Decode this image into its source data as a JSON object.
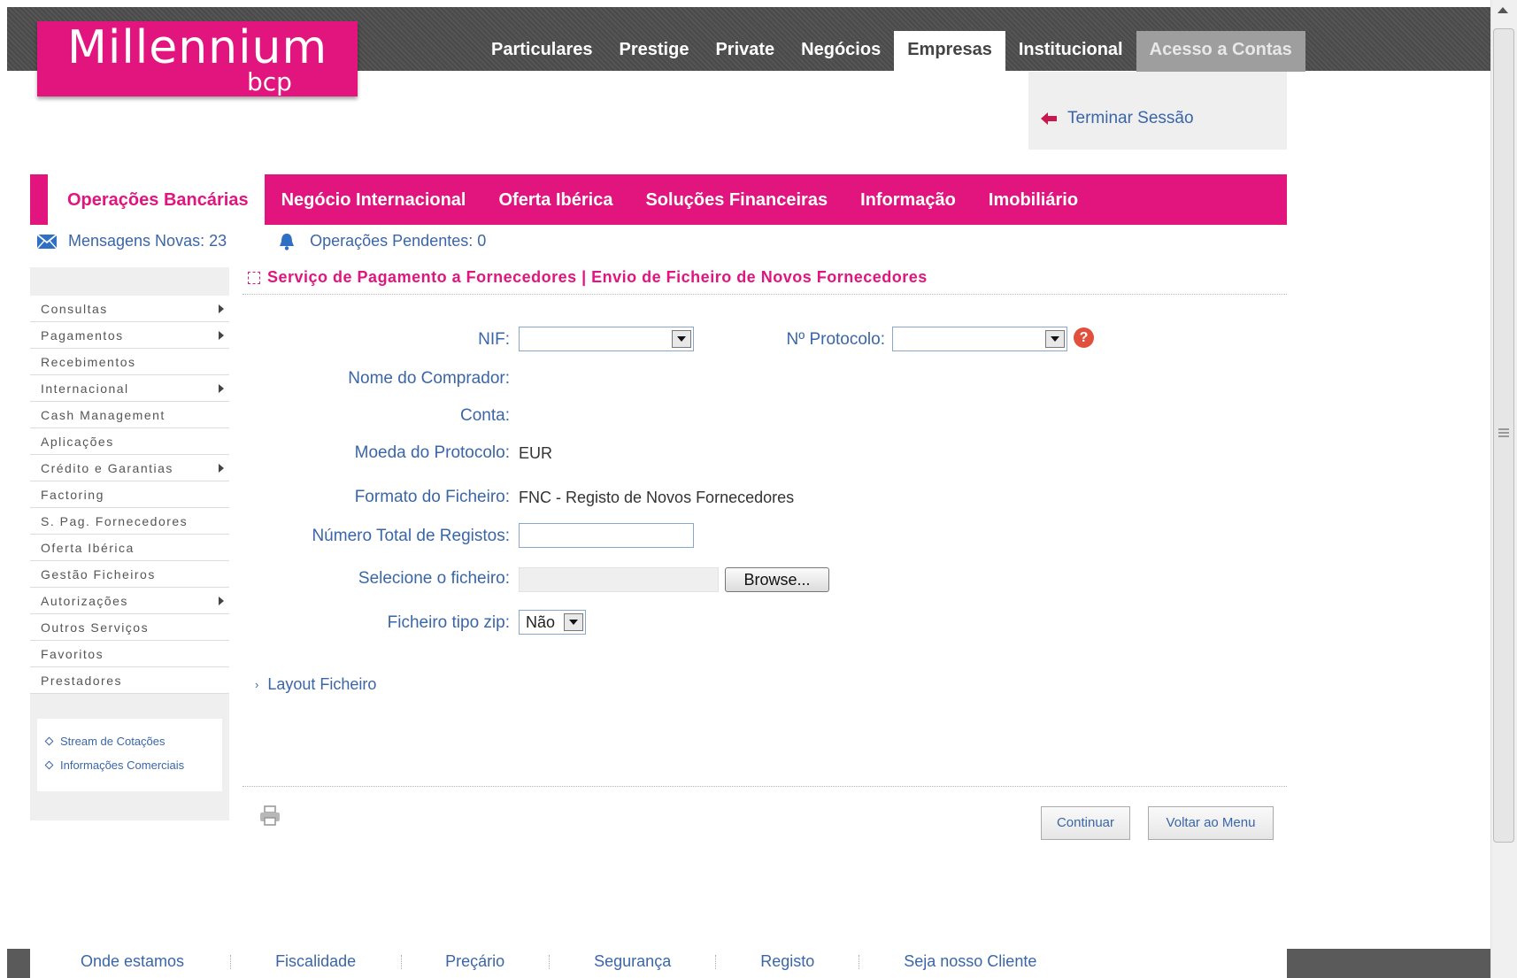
{
  "brand": {
    "name": "Millennium",
    "sub": "bcp",
    "color": "#e2157e"
  },
  "topnav": [
    {
      "label": "Particulares"
    },
    {
      "label": "Prestige"
    },
    {
      "label": "Private"
    },
    {
      "label": "Negócios"
    },
    {
      "label": "Empresas",
      "active": true
    },
    {
      "label": "Institucional"
    },
    {
      "label": "Acesso a Contas"
    }
  ],
  "session": {
    "logout_label": "Terminar Sessão"
  },
  "mainnav": [
    {
      "label": "Operações Bancárias",
      "active": true
    },
    {
      "label": "Negócio Internacional"
    },
    {
      "label": "Oferta Ibérica"
    },
    {
      "label": "Soluções Financeiras"
    },
    {
      "label": "Informação"
    },
    {
      "label": "Imobiliário"
    }
  ],
  "status": {
    "messages": "Mensagens Novas: 23",
    "pending": "Operações Pendentes: 0"
  },
  "sidebar": {
    "items": [
      {
        "label": "Consultas",
        "submenu": true
      },
      {
        "label": "Pagamentos",
        "submenu": true
      },
      {
        "label": "Recebimentos",
        "submenu": false
      },
      {
        "label": "Internacional",
        "submenu": true
      },
      {
        "label": "Cash Management",
        "submenu": false
      },
      {
        "label": "Aplicações",
        "submenu": false
      },
      {
        "label": "Crédito e Garantias",
        "submenu": true
      },
      {
        "label": "Factoring",
        "submenu": false
      },
      {
        "label": "S. Pag. Fornecedores",
        "submenu": false
      },
      {
        "label": "Oferta Ibérica",
        "submenu": false
      },
      {
        "label": "Gestão Ficheiros",
        "submenu": false
      },
      {
        "label": "Autorizações",
        "submenu": true
      },
      {
        "label": "Outros Serviços",
        "submenu": false
      },
      {
        "label": "Favoritos",
        "submenu": false
      },
      {
        "label": "Prestadores",
        "submenu": false
      }
    ],
    "links": [
      {
        "label": "Stream de Cotações"
      },
      {
        "label": "Informações Comerciais"
      }
    ]
  },
  "page": {
    "title": "Serviço de Pagamento a Fornecedores | Envio de Ficheiro de Novos Fornecedores"
  },
  "form": {
    "nif_label": "NIF:",
    "nif_value": "",
    "protocolo_label": "Nº Protocolo:",
    "protocolo_value": "",
    "help_glyph": "?",
    "comprador_label": "Nome do Comprador:",
    "comprador_value": "",
    "conta_label": "Conta:",
    "conta_value": "",
    "moeda_label": "Moeda do Protocolo:",
    "moeda_value": "EUR",
    "formato_label": "Formato do Ficheiro:",
    "formato_value": "FNC - Registo de Novos Fornecedores",
    "registos_label": "Número Total de Registos:",
    "registos_value": "",
    "ficheiro_label": "Selecione o ficheiro:",
    "browse_label": "Browse...",
    "zip_label": "Ficheiro tipo zip:",
    "zip_value": "Não"
  },
  "layout_link": {
    "label": "Layout Ficheiro"
  },
  "actions": {
    "continue_label": "Continuar",
    "back_label": "Voltar ao Menu"
  },
  "footer": [
    {
      "label": "Onde estamos"
    },
    {
      "label": "Fiscalidade"
    },
    {
      "label": "Preçário"
    },
    {
      "label": "Segurança"
    },
    {
      "label": "Registo"
    },
    {
      "label": "Seja nosso Cliente"
    }
  ],
  "icons": {
    "logout": "left-arrow-icon",
    "messages": "envelope-icon",
    "pending": "bell-icon",
    "print": "printer-icon",
    "help": "help-icon"
  }
}
